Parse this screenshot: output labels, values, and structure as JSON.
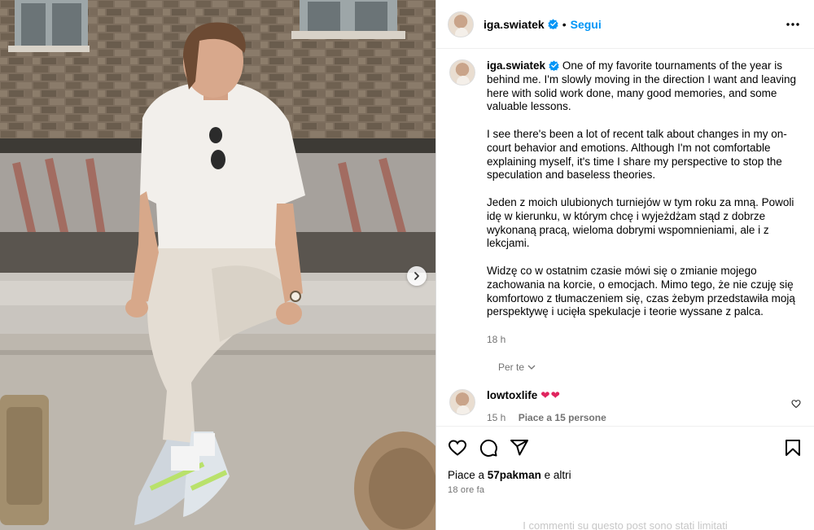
{
  "post": {
    "username": "iga.swiatek",
    "follow_label": "Segui",
    "separator": "•"
  },
  "caption": {
    "username": "iga.swiatek",
    "paragraphs": [
      "One of my favorite tournaments of the year is behind me. I'm slowly moving in the direction I want and leaving here with solid work done, many good memories, and some valuable lessons.",
      "I see there's been a lot of recent talk about changes in my on-court behavior and emotions. Although I'm not comfortable explaining myself, it's time I share my perspective to stop the speculation and baseless theories.",
      "Jeden z moich ulubionych turniejów w tym roku za mną. Powoli idę w kierunku, w którym chcę i wyjeżdżam stąd z dobrze wykonaną pracą, wieloma dobrymi wspomnieniami, ale i z lekcjami.",
      "Widzę co w ostatnim czasie mówi się o zmianie mojego zachowania na korcie, o emocjach. Mimo tego, że nie czuję się komfortowo z tłumaczeniem się, czas żebym przedstawiła moją perspektywę i ucięła spekulacje i teorie wyssane z palca."
    ],
    "time": "18 h",
    "translate_label": "Per te"
  },
  "comments": [
    {
      "username": "lowtoxlife",
      "text": "❤❤",
      "time": "15 h",
      "likes": "Piace a 15 persone"
    }
  ],
  "actions": {
    "likes_prefix": "Piace a ",
    "likes_user": "57pakman",
    "likes_suffix": " e altri",
    "timestamp": "18 ore fa",
    "comments_limited": "I commenti su questo post sono stati limitati"
  },
  "colors": {
    "accent": "#0095f6",
    "verified": "#0095f6",
    "heart": "#e0245e",
    "muted": "#737373"
  }
}
